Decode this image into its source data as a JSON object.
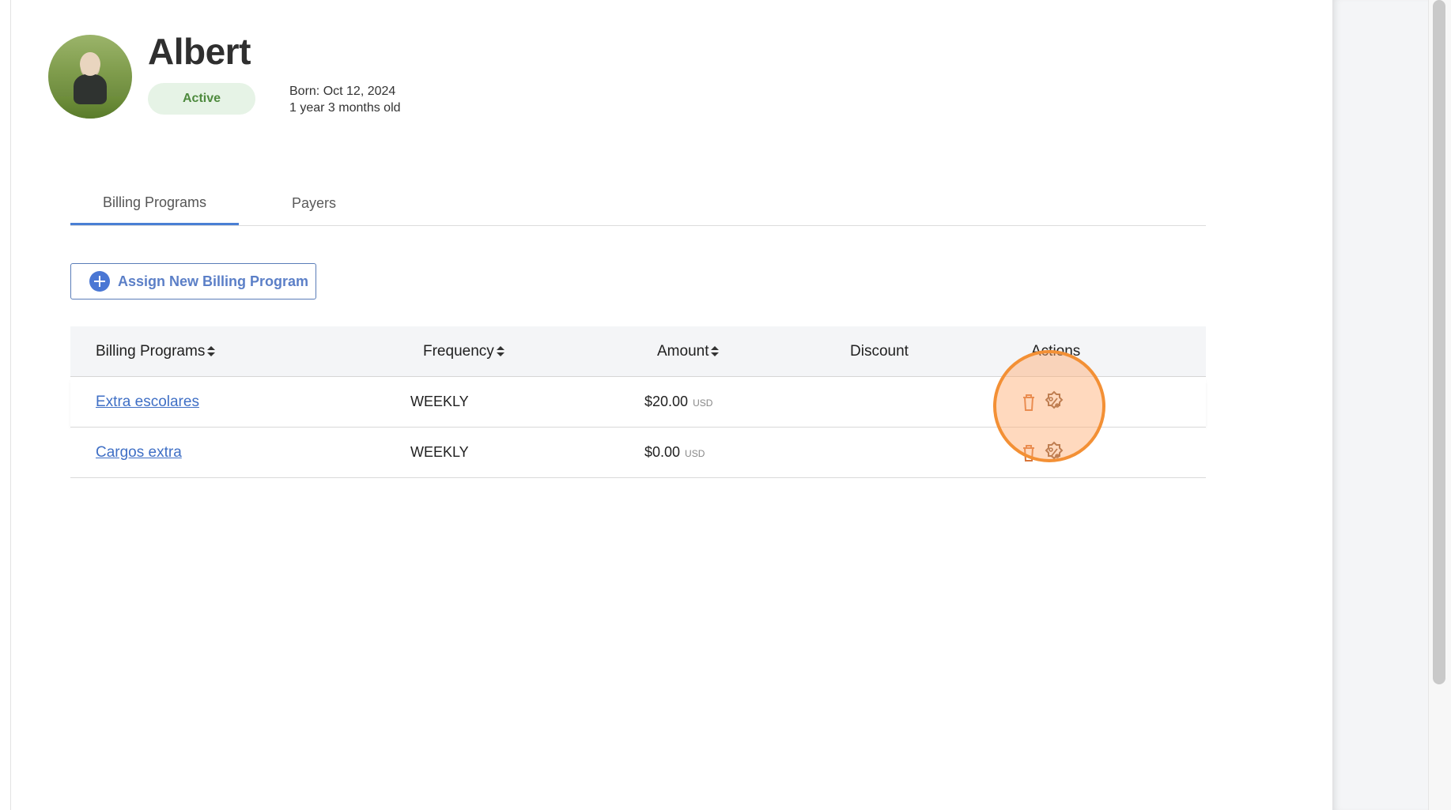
{
  "profile": {
    "name": "Albert",
    "status": "Active",
    "born": "Born: Oct 12, 2024",
    "age": "1 year 3 months old"
  },
  "tabs": [
    {
      "label": "Billing Programs",
      "active": true
    },
    {
      "label": "Payers",
      "active": false
    }
  ],
  "assign_button": {
    "label": "Assign New Billing Program",
    "icon": "plus-circle-icon"
  },
  "table": {
    "headers": {
      "program": "Billing Programs",
      "frequency": "Frequency",
      "amount": "Amount",
      "discount": "Discount",
      "actions": "Actions"
    },
    "rows": [
      {
        "program": "Extra escolares",
        "frequency": "WEEKLY",
        "amount": "$20.00",
        "currency": "USD",
        "discount": ""
      },
      {
        "program": "Cargos extra",
        "frequency": "WEEKLY",
        "amount": "$0.00",
        "currency": "USD",
        "discount": ""
      }
    ]
  },
  "colors": {
    "accent": "#4a7fd4",
    "status_bg": "#e6f3e6",
    "status_text": "#4e8a3e",
    "highlight": "#f39035"
  }
}
